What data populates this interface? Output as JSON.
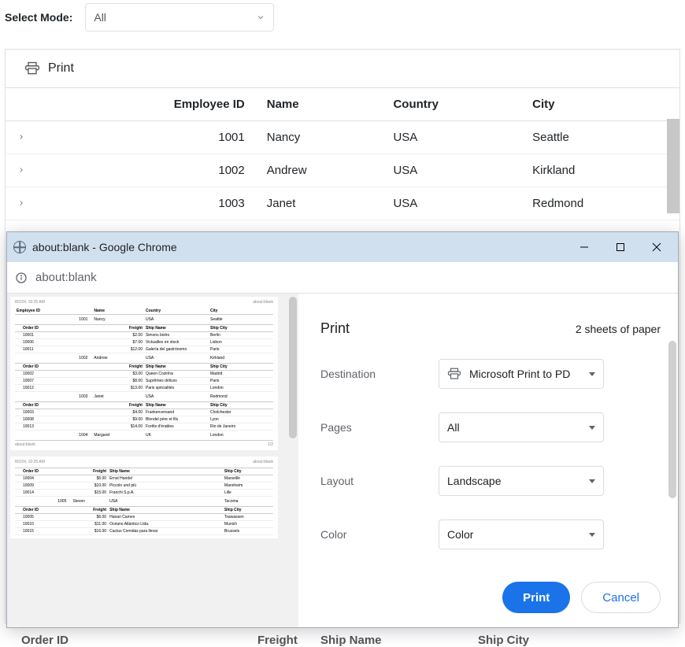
{
  "mode": {
    "label": "Select Mode:",
    "value": "All"
  },
  "toolbar": {
    "print": "Print"
  },
  "grid": {
    "headers": {
      "empid": "Employee ID",
      "name": "Name",
      "country": "Country",
      "city": "City"
    },
    "rows": [
      {
        "empid": "1001",
        "name": "Nancy",
        "country": "USA",
        "city": "Seattle"
      },
      {
        "empid": "1002",
        "name": "Andrew",
        "country": "USA",
        "city": "Kirkland"
      },
      {
        "empid": "1003",
        "name": "Janet",
        "country": "USA",
        "city": "Redmond"
      }
    ],
    "child_headers": {
      "orderid": "Order ID",
      "freight": "Freight",
      "shipname": "Ship Name",
      "shipcity": "Ship City"
    }
  },
  "chrome": {
    "title": "about:blank - Google Chrome",
    "address": "about:blank"
  },
  "print": {
    "title": "Print",
    "sheets": "2 sheets of paper",
    "labels": {
      "destination": "Destination",
      "pages": "Pages",
      "layout": "Layout",
      "color": "Color"
    },
    "values": {
      "destination": "Microsoft Print to PD",
      "pages": "All",
      "layout": "Landscape",
      "color": "Color"
    },
    "buttons": {
      "print": "Print",
      "cancel": "Cancel"
    }
  },
  "preview": {
    "timestamp": "8/2/24, 10:25 AM",
    "url": "about:blank",
    "headers": {
      "empid": "Employee ID",
      "name": "Name",
      "country": "Country",
      "city": "City"
    },
    "sub_headers": {
      "orderid": "Order ID",
      "freight": "Freight",
      "shipname": "Ship Name",
      "shipcity": "Ship City"
    },
    "page1": {
      "employees": [
        {
          "empid": "1001",
          "name": "Nancy",
          "country": "USA",
          "city": "Seattle",
          "orders": [
            {
              "id": "10001",
              "freight": "$2.00",
              "ship": "Simons bistro",
              "city": "Berlin"
            },
            {
              "id": "10006",
              "freight": "$7.00",
              "ship": "Victuailles en stock",
              "city": "Lisbon"
            },
            {
              "id": "10011",
              "freight": "$12.00",
              "ship": "Galería del gastrónomo",
              "city": "Paris"
            }
          ]
        },
        {
          "empid": "1002",
          "name": "Andrew",
          "country": "USA",
          "city": "Kirkland",
          "orders": [
            {
              "id": "10002",
              "freight": "$3.00",
              "ship": "Queen Cozinha",
              "city": "Madrid"
            },
            {
              "id": "10007",
              "freight": "$8.00",
              "ship": "Suprêmes délices",
              "city": "Paris"
            },
            {
              "id": "10012",
              "freight": "$13.00",
              "ship": "Paris spécialités",
              "city": "London"
            }
          ]
        },
        {
          "empid": "1003",
          "name": "Janet",
          "country": "USA",
          "city": "Redmond",
          "orders": [
            {
              "id": "10003",
              "freight": "$4.00",
              "ship": "Frankenversand",
              "city": "Cholchester"
            },
            {
              "id": "10008",
              "freight": "$9.00",
              "ship": "Blondel père et fils",
              "city": "Lyon"
            },
            {
              "id": "10013",
              "freight": "$14.00",
              "ship": "Forêts d'érables",
              "city": "Rio de Janeiro"
            }
          ]
        },
        {
          "empid": "1004",
          "name": "Margaret",
          "country": "UK",
          "city": "London",
          "orders": []
        }
      ],
      "footer_left": "about:blank",
      "footer_right": "1/2"
    },
    "page2": {
      "employees": [
        {
          "empid": "",
          "name": "",
          "country": "",
          "city": "",
          "orders": [
            {
              "id": "10004",
              "freight": "$5.00",
              "ship": "Ernst Handel",
              "city": "Marseille"
            },
            {
              "id": "10009",
              "freight": "$10.00",
              "ship": "Piccolo und più",
              "city": "Mannheim"
            },
            {
              "id": "10014",
              "freight": "$15.00",
              "ship": "Franchi S.p.A.",
              "city": "Lille"
            }
          ]
        },
        {
          "empid": "1005",
          "name": "Steven",
          "country": "USA",
          "city": "Tacoma",
          "orders": [
            {
              "id": "10005",
              "freight": "$6.00",
              "ship": "Hanari Carnes",
              "city": "Tsawassen"
            },
            {
              "id": "10010",
              "freight": "$11.00",
              "ship": "Océano Atlántico Ltda.",
              "city": "Munich"
            },
            {
              "id": "10015",
              "freight": "$16.00",
              "ship": "Cactus Comidas para llevar",
              "city": "Brussels"
            }
          ]
        }
      ]
    }
  }
}
